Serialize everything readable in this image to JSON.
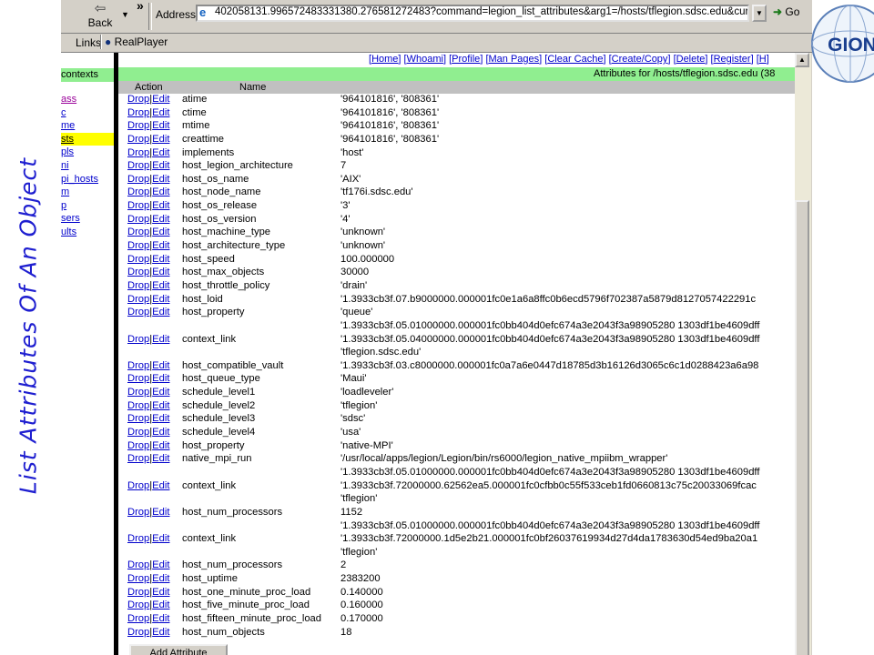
{
  "slide_title": "List Attributes Of An Object",
  "toolbar": {
    "back_label": "Back",
    "address_label": "Address",
    "address_value": "402058131.996572483331380.276581272483?command=legion_list_attributes&arg1=/hosts/tflegion.sdsc.edu&currdir=/hosts",
    "go_label": "Go"
  },
  "links_bar": {
    "links_label": "Links",
    "realplayer_label": "RealPlayer"
  },
  "logo_text": "GION",
  "left_frame": {
    "header": "contexts",
    "items": [
      "ass",
      "c",
      "me",
      "sts",
      "pls",
      "ni",
      "pi_hosts",
      "m",
      "p",
      "sers",
      "ults"
    ]
  },
  "nav_links": [
    "Home",
    "Whoami",
    "Profile",
    "Man Pages",
    "Clear Cache",
    "Create/Copy",
    "Delete",
    "Register",
    "H"
  ],
  "attributes_header": "Attributes for /hosts/tflegion.sdsc.edu (38",
  "columns": {
    "action": "Action",
    "name": "Name"
  },
  "drop_label": "Drop",
  "edit_label": "Edit",
  "rows": [
    {
      "name": "atime",
      "values": [
        "'964101816', '808361'"
      ]
    },
    {
      "name": "ctime",
      "values": [
        "'964101816', '808361'"
      ]
    },
    {
      "name": "mtime",
      "values": [
        "'964101816', '808361'"
      ]
    },
    {
      "name": "creattime",
      "values": [
        "'964101816', '808361'"
      ]
    },
    {
      "name": "implements",
      "values": [
        "'host'"
      ]
    },
    {
      "name": "host_legion_architecture",
      "values": [
        "7"
      ]
    },
    {
      "name": "host_os_name",
      "values": [
        "'AIX'"
      ]
    },
    {
      "name": "host_node_name",
      "values": [
        "'tf176i.sdsc.edu'"
      ]
    },
    {
      "name": "host_os_release",
      "values": [
        "'3'"
      ]
    },
    {
      "name": "host_os_version",
      "values": [
        "'4'"
      ]
    },
    {
      "name": "host_machine_type",
      "values": [
        "'unknown'"
      ]
    },
    {
      "name": "host_architecture_type",
      "values": [
        "'unknown'"
      ]
    },
    {
      "name": "host_speed",
      "values": [
        "100.000000"
      ]
    },
    {
      "name": "host_max_objects",
      "values": [
        "30000"
      ]
    },
    {
      "name": "host_throttle_policy",
      "values": [
        "'drain'"
      ]
    },
    {
      "name": "host_loid",
      "values": [
        "'1.3933cb3f.07.b9000000.000001fc0e1a6a8ffc0b6ecd5796f702387a5879d8127057422291c"
      ]
    },
    {
      "name": "host_property",
      "values": [
        "'queue'"
      ]
    },
    {
      "name": "context_link",
      "values": [
        "'1.3933cb3f.05.01000000.000001fc0bb404d0efc674a3e2043f3a98905280 1303df1be4609dff",
        "'1.3933cb3f.05.04000000.000001fc0bb404d0efc674a3e2043f3a98905280 1303df1be4609dff",
        "'tflegion.sdsc.edu'"
      ]
    },
    {
      "name": "host_compatible_vault",
      "values": [
        "'1.3933cb3f.03.c8000000.000001fc0a7a6e0447d18785d3b16126d3065c6c1d0288423a6a98"
      ]
    },
    {
      "name": "host_queue_type",
      "values": [
        "'Maui'"
      ]
    },
    {
      "name": "schedule_level1",
      "values": [
        "'loadleveler'"
      ]
    },
    {
      "name": "schedule_level2",
      "values": [
        "'tflegion'"
      ]
    },
    {
      "name": "schedule_level3",
      "values": [
        "'sdsc'"
      ]
    },
    {
      "name": "schedule_level4",
      "values": [
        "'usa'"
      ]
    },
    {
      "name": "host_property",
      "values": [
        "'native-MPI'"
      ]
    },
    {
      "name": "native_mpi_run",
      "values": [
        "'/usr/local/apps/legion/Legion/bin/rs6000/legion_native_mpiibm_wrapper'"
      ]
    },
    {
      "name": "context_link",
      "values": [
        "'1.3933cb3f.05.01000000.000001fc0bb404d0efc674a3e2043f3a98905280 1303df1be4609dff",
        "'1.3933cb3f.72000000.62562ea5.000001fc0cfbb0c55f533ceb1fd0660813c75c20033069fcac",
        "'tflegion'"
      ]
    },
    {
      "name": "host_num_processors",
      "values": [
        "1152"
      ]
    },
    {
      "name": "context_link",
      "values": [
        "'1.3933cb3f.05.01000000.000001fc0bb404d0efc674a3e2043f3a98905280 1303df1be4609dff",
        "'1.3933cb3f.72000000.1d5e2b21.000001fc0bf26037619934d27d4da1783630d54ed9ba20a1",
        "'tflegion'"
      ]
    },
    {
      "name": "host_num_processors",
      "values": [
        "2"
      ]
    },
    {
      "name": "host_uptime",
      "values": [
        "2383200"
      ]
    },
    {
      "name": "host_one_minute_proc_load",
      "values": [
        "0.140000"
      ]
    },
    {
      "name": "host_five_minute_proc_load",
      "values": [
        "0.160000"
      ]
    },
    {
      "name": "host_fifteen_minute_proc_load",
      "values": [
        "0.170000"
      ]
    },
    {
      "name": "host_num_objects",
      "values": [
        "18"
      ]
    }
  ],
  "add_attribute_label": "Add Attribute"
}
